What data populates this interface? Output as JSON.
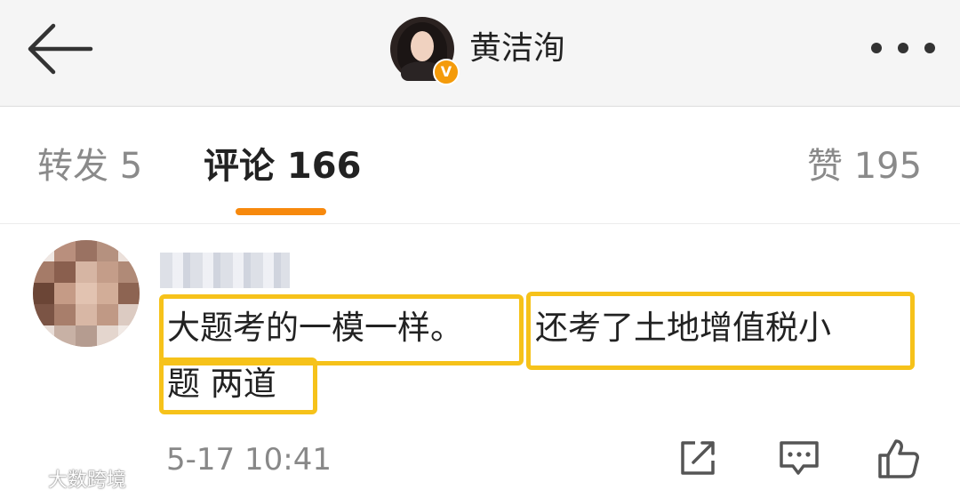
{
  "header": {
    "user_name": "黄洁洵",
    "verified_badge": "V",
    "icons": {
      "back": "arrow-left-icon",
      "more": "more-dots-icon"
    }
  },
  "tabs": {
    "repost_label": "转发 5",
    "comment_label": "评论 166",
    "likes_label": "赞 195",
    "active": "comment",
    "accent_color": "#f7890d"
  },
  "comment": {
    "text_line1_part1": "大题考的一模一样。",
    "text_line1_part2": "还考了土地增值税小",
    "text_line2": "题 两道",
    "time": "5-17 10:41",
    "highlight_color": "#f6c21a",
    "icons": {
      "repost": "repost-icon",
      "reply": "reply-comment-icon",
      "like": "thumbs-up-icon"
    }
  },
  "watermark": {
    "text": "大数跨境"
  }
}
